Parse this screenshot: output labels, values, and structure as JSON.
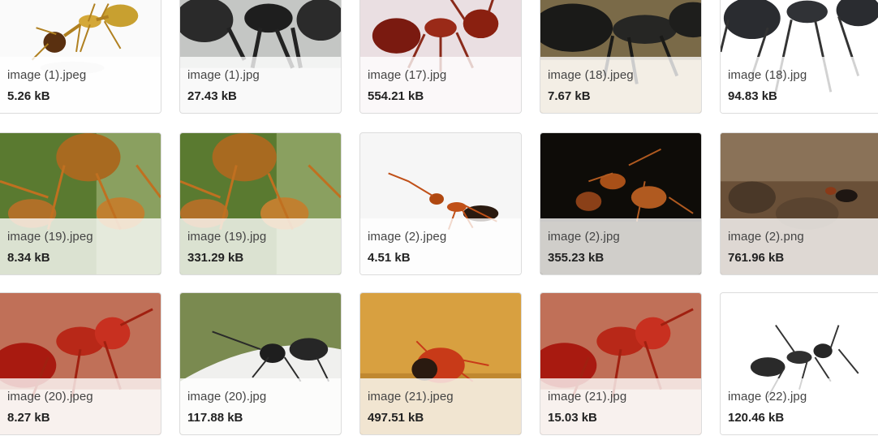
{
  "files": [
    {
      "name": "image (1).jpeg",
      "size": "5.26 kB",
      "thumb": "yellow-ant-white-bg"
    },
    {
      "name": "image (1).jpg",
      "size": "27.43 kB",
      "thumb": "black-ants-grey-bg"
    },
    {
      "name": "image (17).jpg",
      "size": "554.21 kB",
      "thumb": "red-ant-pink-bg"
    },
    {
      "name": "image (18).jpeg",
      "size": "7.67 kB",
      "thumb": "black-ant-closeup-dark"
    },
    {
      "name": "image (18).jpg",
      "size": "94.83 kB",
      "thumb": "black-ant-white-bg"
    },
    {
      "name": "image (19).jpeg",
      "size": "8.34 kB",
      "thumb": "orange-ants-green-leaf"
    },
    {
      "name": "image (19).jpg",
      "size": "331.29 kB",
      "thumb": "orange-ants-green-leaf"
    },
    {
      "name": "image (2).jpeg",
      "size": "4.51 kB",
      "thumb": "orange-ant-white-bg"
    },
    {
      "name": "image (2).jpg",
      "size": "355.23 kB",
      "thumb": "orange-ants-black-bg"
    },
    {
      "name": "image (2).png",
      "size": "761.96 kB",
      "thumb": "ant-brown-soil"
    },
    {
      "name": "image (20).jpeg",
      "size": "8.27 kB",
      "thumb": "red-ant-brown-bg"
    },
    {
      "name": "image (20).jpg",
      "size": "117.88 kB",
      "thumb": "black-ant-green-bg"
    },
    {
      "name": "image (21).jpeg",
      "size": "497.51 kB",
      "thumb": "red-ant-tan-bg"
    },
    {
      "name": "image (21).jpg",
      "size": "15.03 kB",
      "thumb": "red-ant-brown-bg"
    },
    {
      "name": "image (22).jpg",
      "size": "120.46 kB",
      "thumb": "black-ant-white-bg"
    }
  ]
}
